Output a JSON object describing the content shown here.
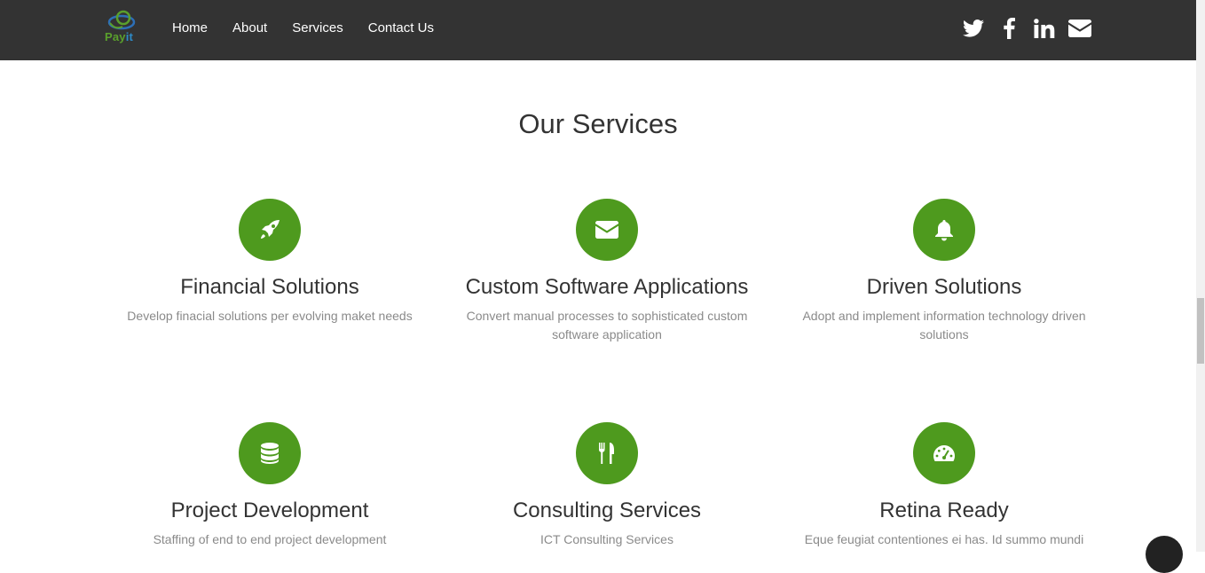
{
  "brand": {
    "logo_text_1": "Pay",
    "logo_text_2": "it",
    "accent": "#4e9a1e",
    "nav_background": "#333333"
  },
  "nav": {
    "items": [
      {
        "label": "Home"
      },
      {
        "label": "About"
      },
      {
        "label": "Services"
      },
      {
        "label": "Contact Us"
      }
    ],
    "social": [
      "twitter-icon",
      "facebook-icon",
      "linkedin-icon",
      "envelope-icon"
    ]
  },
  "services": {
    "title": "Our Services",
    "items": [
      {
        "icon": "rocket-icon",
        "title": "Financial Solutions",
        "desc": "Develop finacial solutions per evolving maket needs"
      },
      {
        "icon": "envelope-icon",
        "title": "Custom Software Applications",
        "desc": "Convert manual processes to sophisticated custom software application"
      },
      {
        "icon": "bell-icon",
        "title": "Driven Solutions",
        "desc": "Adopt and implement information technology driven solutions"
      },
      {
        "icon": "database-icon",
        "title": "Project Development",
        "desc": "Staffing of end to end project development"
      },
      {
        "icon": "cutlery-icon",
        "title": "Consulting Services",
        "desc": "ICT Consulting Services"
      },
      {
        "icon": "dashboard-icon",
        "title": "Retina Ready",
        "desc": "Eque feugiat contentiones ei has. Id summo mundi"
      }
    ]
  }
}
